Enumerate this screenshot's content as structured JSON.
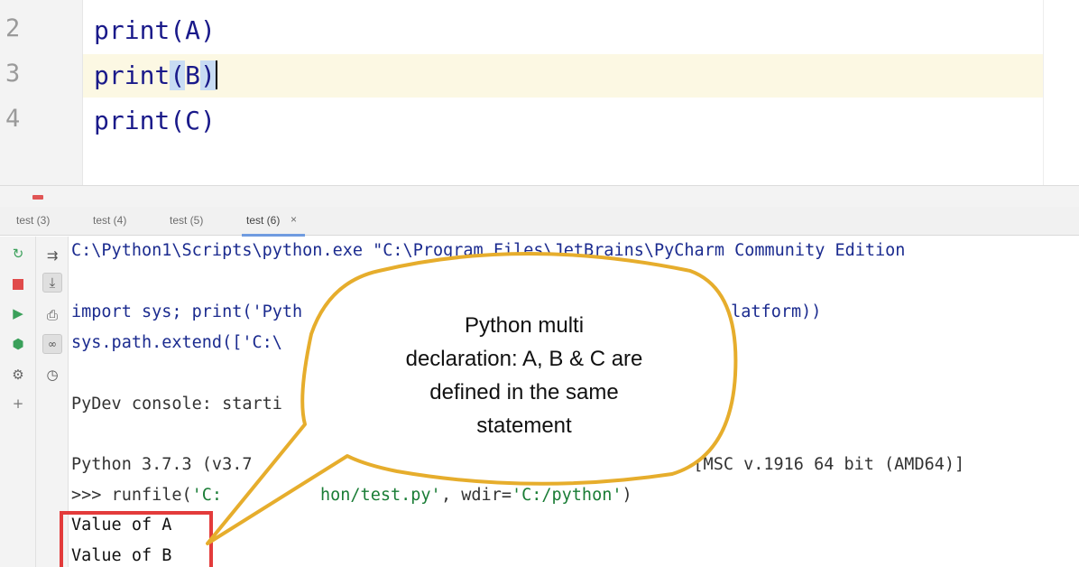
{
  "editor": {
    "line_numbers": [
      "2",
      "3",
      "4"
    ],
    "lines": {
      "l2": "print(A)",
      "l3_prefix": "print",
      "l3_open": "(",
      "l3_arg": "B",
      "l3_close": ")",
      "l4": "print(C)"
    }
  },
  "tabs": [
    "test (3)",
    "test (4)",
    "test (5)",
    "test (6)"
  ],
  "console": {
    "line1": "C:\\Python1\\Scripts\\python.exe \"C:\\Program Files\\JetBrains\\PyCharm Community Edition",
    "line2_a": "import sys; print('Pyth",
    "line2_b": "platform))",
    "line3": "sys.path.extend(['C:\\",
    "line4": "PyDev console: starti",
    "line5": "Python 3.7.3 (v3.7",
    "line5_b": "5) [MSC v.1916 64 bit (AMD64)]",
    "line6_prompt": ">>> runfile(",
    "line6_str1": "'C:",
    "line6_str2": "hon/test.py'",
    "line6_mid": ", wdir=",
    "line6_str3": "'C:/python'",
    "line6_end": ")",
    "output": [
      "Value of A",
      "Value of B"
    ]
  },
  "callout": {
    "lines": [
      "Python multi",
      "declaration: A, B & C are",
      "defined in the same",
      "statement"
    ],
    "border_color": "#e6ad2c"
  },
  "colors": {
    "current_line": "#fcf8e3",
    "brace_highlight": "#c8dcf3",
    "output_box": "#e33b3b"
  }
}
